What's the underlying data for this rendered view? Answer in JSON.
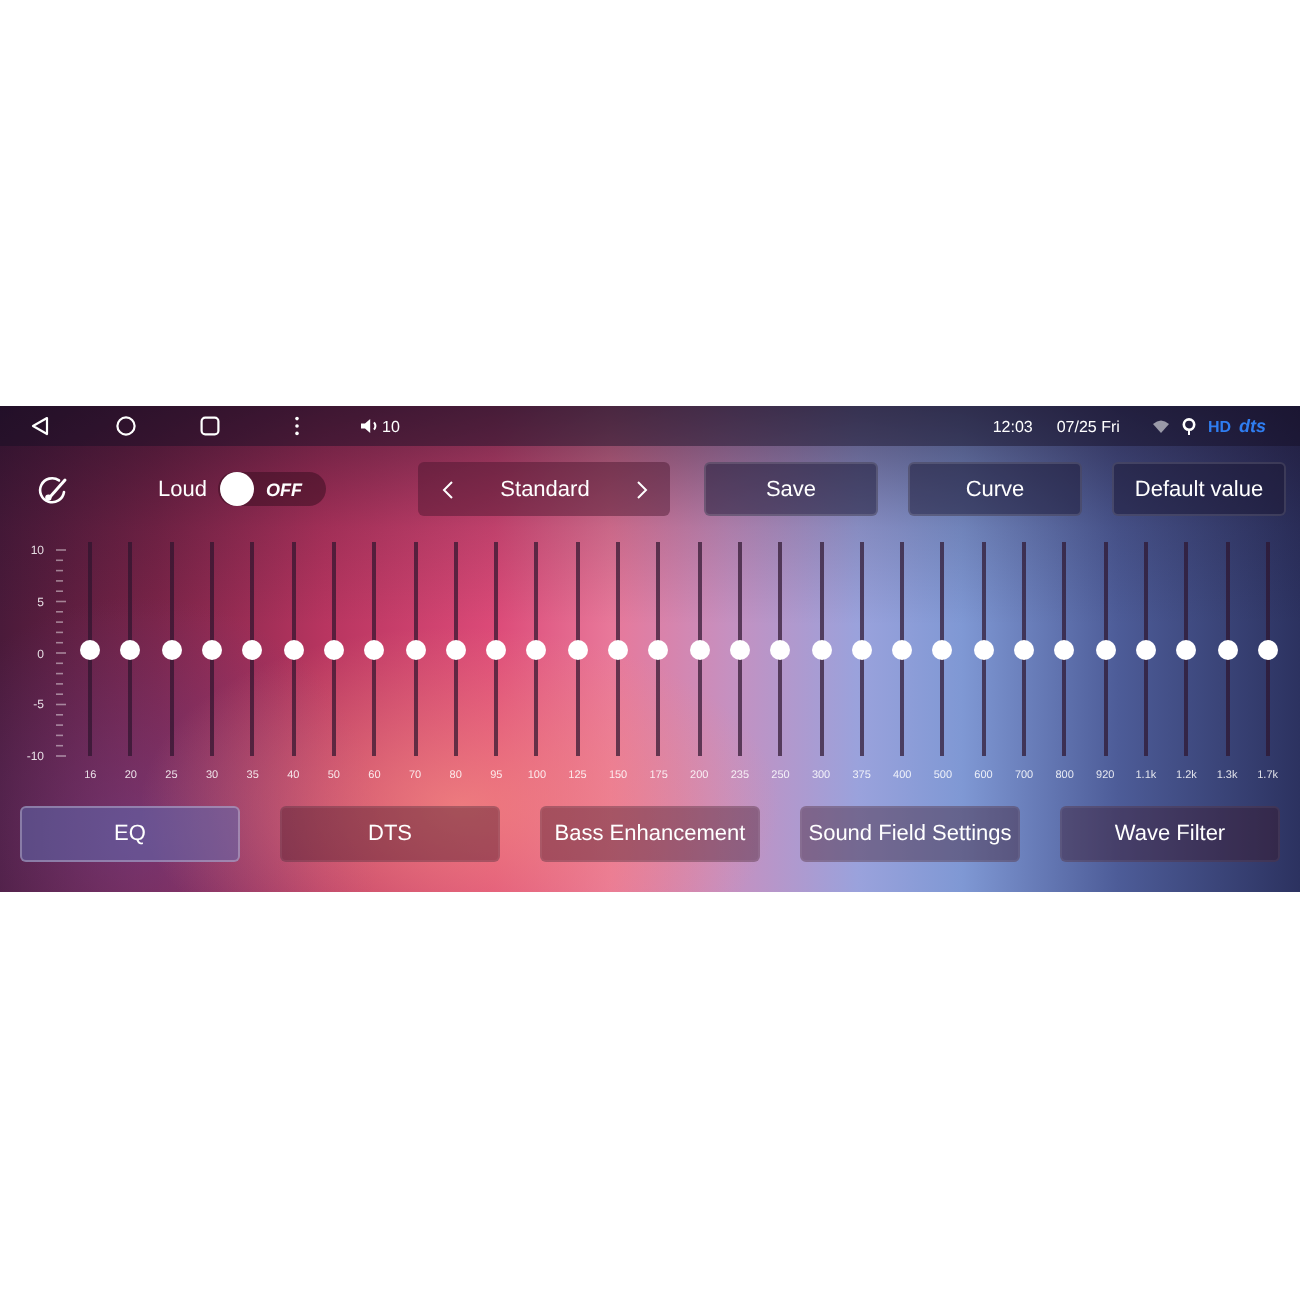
{
  "status_bar": {
    "volume": "10",
    "time": "12:03",
    "date": "07/25 Fri",
    "badges": [
      {
        "text": "HD",
        "kind": "plain"
      },
      {
        "text": "dts",
        "kind": "logo"
      }
    ]
  },
  "toolbar": {
    "loud": {
      "label": "Loud",
      "on": false,
      "state": "OFF"
    },
    "preset": {
      "value": "Standard"
    },
    "buttons": [
      "Save",
      "Curve",
      "Default value"
    ]
  },
  "equalizer": {
    "scale": [
      "10",
      "5",
      "0",
      "-5",
      "-10"
    ],
    "bands": [
      {
        "freq": "16",
        "level": 0.5
      },
      {
        "freq": "20",
        "level": 0.5
      },
      {
        "freq": "25",
        "level": 0.5
      },
      {
        "freq": "30",
        "level": 0.5
      },
      {
        "freq": "35",
        "level": 0.5
      },
      {
        "freq": "40",
        "level": 0.5
      },
      {
        "freq": "50",
        "level": 0.5
      },
      {
        "freq": "60",
        "level": 0.5
      },
      {
        "freq": "70",
        "level": 0.5
      },
      {
        "freq": "80",
        "level": 0.5
      },
      {
        "freq": "95",
        "level": 0.5
      },
      {
        "freq": "100",
        "level": 0.5
      },
      {
        "freq": "125",
        "level": 0.5
      },
      {
        "freq": "150",
        "level": 0.5
      },
      {
        "freq": "175",
        "level": 0.5
      },
      {
        "freq": "200",
        "level": 0.5
      },
      {
        "freq": "235",
        "level": 0.5
      },
      {
        "freq": "250",
        "level": 0.5
      },
      {
        "freq": "300",
        "level": 0.5
      },
      {
        "freq": "375",
        "level": 0.5
      },
      {
        "freq": "400",
        "level": 0.5
      },
      {
        "freq": "500",
        "level": 0.5
      },
      {
        "freq": "600",
        "level": 0.5
      },
      {
        "freq": "700",
        "level": 0.5
      },
      {
        "freq": "800",
        "level": 0.5
      },
      {
        "freq": "920",
        "level": 0.5
      },
      {
        "freq": "1.1k",
        "level": 0.5
      },
      {
        "freq": "1.2k",
        "level": 0.5
      },
      {
        "freq": "1.3k",
        "level": 0.5
      },
      {
        "freq": "1.7k",
        "level": 0.5
      }
    ]
  },
  "tabs": [
    {
      "label": "EQ",
      "selected": true
    },
    {
      "label": "DTS",
      "selected": false
    },
    {
      "label": "Bass Enhancement",
      "selected": false
    },
    {
      "label": "Sound Field Settings",
      "selected": false
    },
    {
      "label": "Wave Filter",
      "selected": false
    }
  ]
}
